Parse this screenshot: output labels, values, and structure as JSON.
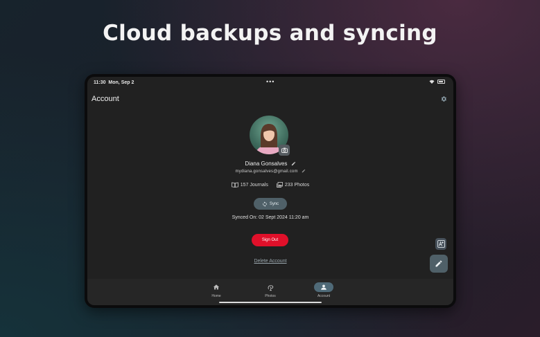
{
  "headline": "Cloud backups and syncing",
  "status_bar": {
    "time": "11:30",
    "date": "Mon, Sep 2",
    "center_dots": "•••"
  },
  "app_bar": {
    "title": "Account"
  },
  "profile": {
    "name": "Diana Gonsalves",
    "email": "mydiana.gonsalves@gmail.com",
    "journals": "157 Journals",
    "photos": "233 Photos"
  },
  "sync": {
    "button_label": "Sync",
    "synced_on": "Synced On: 02 Sept 2024 11:20 am"
  },
  "actions": {
    "sign_out": "Sign Out",
    "delete_account": "Delete Account"
  },
  "bottom_nav": {
    "items": [
      {
        "label": "Home",
        "icon": "home-icon"
      },
      {
        "label": "Photos",
        "icon": "photos-icon"
      },
      {
        "label": "Account",
        "icon": "account-icon",
        "active": true
      }
    ]
  },
  "colors": {
    "accent": "#4f6068",
    "danger": "#e0102a",
    "screen_bg": "#212121"
  }
}
